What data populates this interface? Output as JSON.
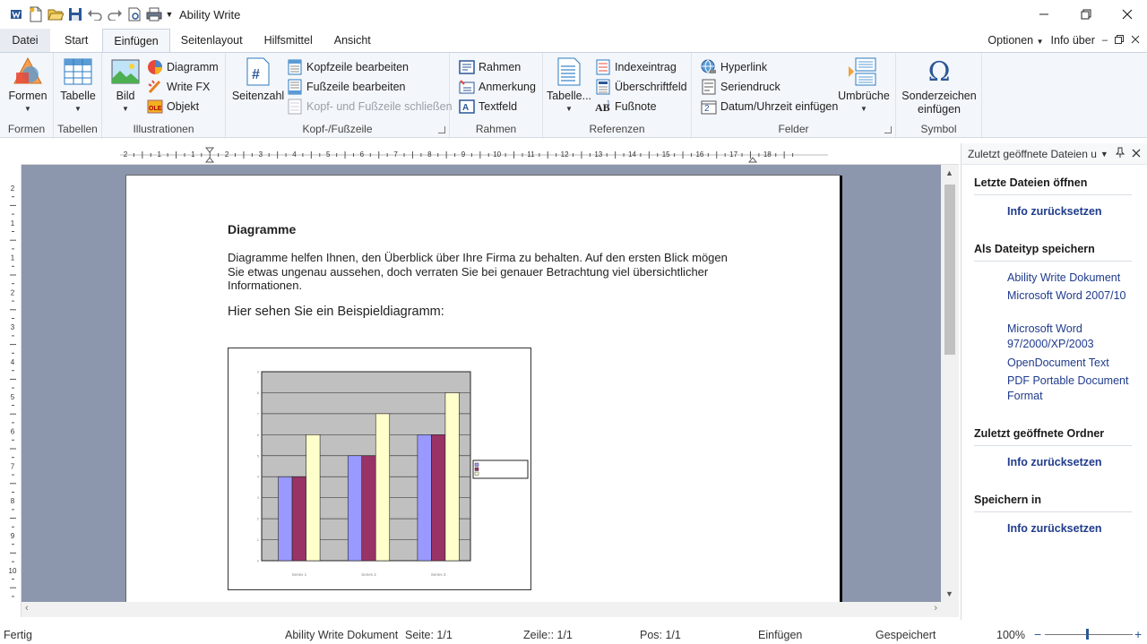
{
  "app": {
    "title": "Ability Write"
  },
  "menu": {
    "tabs": [
      "Datei",
      "Start",
      "Einfügen",
      "Seitenlayout",
      "Hilfsmittel",
      "Ansicht"
    ],
    "active": "Einfügen",
    "options_label": "Optionen",
    "info_label": "Info über"
  },
  "ribbon": {
    "formen": {
      "button": "Formen",
      "group": "Formen"
    },
    "tabellen": {
      "button": "Tabelle",
      "group": "Tabellen"
    },
    "illustrationen": {
      "bild": "Bild",
      "diagramm": "Diagramm",
      "writefx": "Write FX",
      "objekt": "Objekt",
      "group": "Illustrationen"
    },
    "kopf": {
      "seitenzahl": "Seitenzahl",
      "kopfzeile": "Kopfzeile bearbeiten",
      "fusszeile": "Fußzeile bearbeiten",
      "schliessen": "Kopf- und Fußzeile schließen",
      "group": "Kopf-/Fußzeile"
    },
    "rahmen": {
      "rahmen": "Rahmen",
      "anmerkung": "Anmerkung",
      "textfeld": "Textfeld",
      "group": "Rahmen"
    },
    "referenzen": {
      "tabelle": "Tabelle...",
      "index": "Indexeintrag",
      "ueberschrift": "Überschriftfeld",
      "fussnote": "Fußnote",
      "group": "Referenzen"
    },
    "felder": {
      "hyperlink": "Hyperlink",
      "seriendruck": "Seriendruck",
      "datum": "Datum/Uhrzeit einfügen",
      "umbrueche": "Umbrüche",
      "group": "Felder"
    },
    "symbol": {
      "button_line1": "Sonderzeichen",
      "button_line2": "einfügen",
      "group": "Symbol"
    }
  },
  "ruler": {
    "h_numbers": [
      "2",
      "1",
      "1",
      "2",
      "3",
      "4",
      "5",
      "6",
      "7",
      "8",
      "9",
      "10",
      "11",
      "12",
      "13",
      "14",
      "15",
      "16",
      "17",
      "18"
    ],
    "v_numbers": [
      "2",
      "1",
      "1",
      "2",
      "3",
      "4",
      "5",
      "6",
      "7",
      "8",
      "9",
      "10"
    ]
  },
  "document": {
    "heading": "Diagramme",
    "paragraph": "Diagramme helfen Ihnen, den Überblick über Ihre Firma zu behalten. Auf den ersten Blick mögen Sie etwas ungenau aussehen, doch verraten Sie bei genauer Betrachtung viel übersichtlicher Informationen.",
    "caption": "Hier sehen Sie ein Beispieldiagramm:"
  },
  "chart_data": {
    "type": "bar",
    "title": "",
    "categories": [
      "Series 1",
      "Series 2",
      "Series 3"
    ],
    "series": [
      {
        "values": [
          4,
          5,
          6
        ],
        "color": "#9999ff"
      },
      {
        "values": [
          4,
          5,
          6
        ],
        "color": "#993366"
      },
      {
        "values": [
          6,
          7,
          8
        ],
        "color": "#ffffcc"
      }
    ],
    "ylim": [
      0,
      9
    ],
    "grid": true,
    "legend": "right",
    "plot_bg": "#c0c0c0"
  },
  "panel": {
    "title": "Zuletzt geöffnete Dateien u",
    "sections": [
      {
        "heading": "Letzte Dateien öffnen",
        "items": [],
        "reset": "Info zurücksetzen"
      },
      {
        "heading": "Als Dateityp speichern",
        "items": [
          "Ability Write Dokument",
          "Microsoft Word 2007/10",
          "Microsoft Word 97/2000/XP/2003",
          "OpenDocument Text",
          "PDF Portable Document Format"
        ]
      },
      {
        "heading": "Zuletzt geöffnete Ordner",
        "items": [],
        "reset": "Info zurücksetzen"
      },
      {
        "heading": "Speichern in",
        "items": [],
        "reset": "Info zurücksetzen"
      }
    ]
  },
  "status": {
    "ready": "Fertig",
    "doctype": "Ability Write Dokument",
    "page": "Seite: 1/1",
    "line": "Zeile:: 1/1",
    "pos": "Pos: 1/1",
    "mode": "Einfügen",
    "saved": "Gespeichert",
    "zoom": "100%"
  },
  "colors": {
    "accent": "#2b5797",
    "ribbon_bg": "#f3f6fa",
    "workspace": "#8c97ad",
    "link": "#1f3b8c"
  }
}
